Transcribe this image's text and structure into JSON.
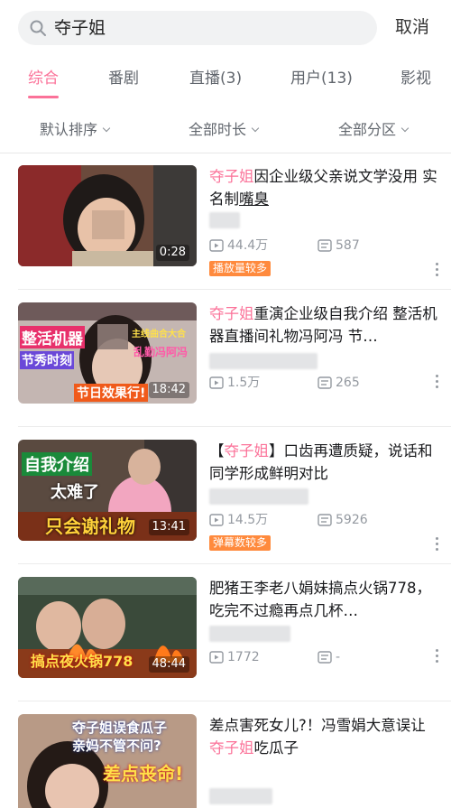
{
  "search": {
    "query": "夺子姐",
    "cancel_label": "取消"
  },
  "tabs": [
    {
      "label": "综合"
    },
    {
      "label": "番剧"
    },
    {
      "label": "直播(3)"
    },
    {
      "label": "用户(13)"
    },
    {
      "label": "影视"
    }
  ],
  "filters": [
    {
      "label": "默认排序"
    },
    {
      "label": "全部时长"
    },
    {
      "label": "全部分区"
    }
  ],
  "colors": {
    "accent": "#fb7299",
    "badge": "#ff8a3d",
    "muted": "#9499a0"
  },
  "icons": {
    "search": "search-icon",
    "play": "play-count-icon",
    "danmaku": "danmaku-count-icon",
    "more": "more-vertical-icon"
  },
  "videos": [
    {
      "title_hl": "夺子姐",
      "title_rest": "因企业级父亲说文学没用 实名制",
      "title_tail": "嘴臭",
      "duration": "0:28",
      "views": "44.4万",
      "danmaku": "587",
      "badge": "播放量较多",
      "thumb_text": []
    },
    {
      "title_hl": "夺子姐",
      "title_rest": "重演企业级自我介绍 整活机器直播间礼物冯阿冯 节…",
      "title_tail": "",
      "duration": "18:42",
      "views": "1.5万",
      "danmaku": "265",
      "badge": "",
      "thumb_text": [
        "整活机器",
        "节秀时刻",
        "主线曲合大合",
        "乱勤冯阿冯",
        "节日效果行!"
      ]
    },
    {
      "title_pre": "【",
      "title_hl": "夺子姐",
      "title_rest": "】口齿再遭质疑，说话和同学形成鲜明对比",
      "title_tail": "",
      "duration": "13:41",
      "views": "14.5万",
      "danmaku": "5926",
      "badge": "弹幕数较多",
      "thumb_text": [
        "自我介绍",
        "太难了",
        "只会谢礼物"
      ]
    },
    {
      "title_plain": "肥猪王李老八娟妹搞点火锅778，吃完不过瘾再点几杯…",
      "duration": "48:44",
      "views": "1772",
      "danmaku": "-",
      "badge": "",
      "thumb_text": [
        "搞点夜火锅778"
      ]
    },
    {
      "title_pre": "差点害死女儿?！冯雪娟大意误让",
      "title_hl": "夺子姐",
      "title_rest": "吃瓜子",
      "title_tail": "",
      "duration": "",
      "views": "",
      "danmaku": "",
      "badge": "",
      "thumb_text": [
        "夺子姐误食瓜子",
        "亲妈不管不问?",
        "差点丧命!"
      ]
    }
  ]
}
